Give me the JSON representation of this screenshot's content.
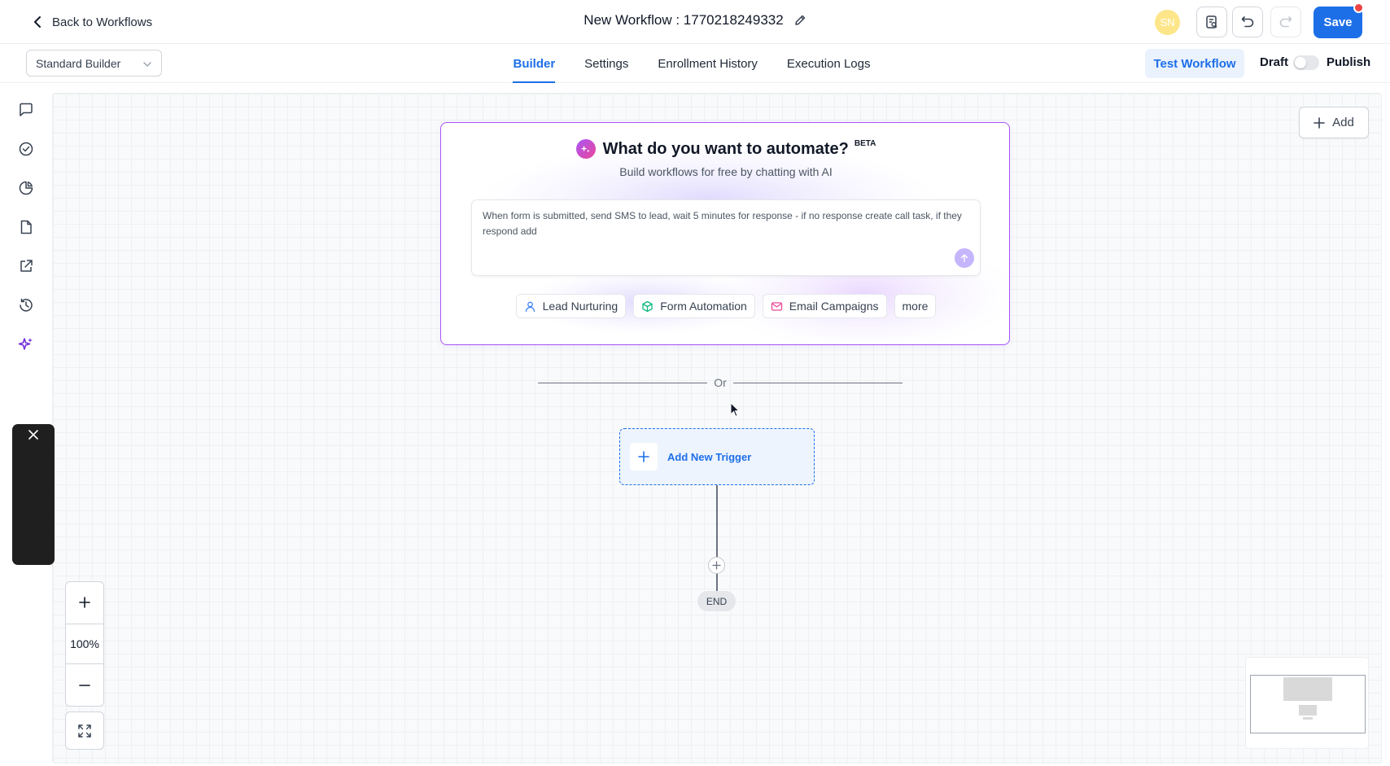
{
  "header": {
    "back_label": "Back to Workflows",
    "workflow_title": "New Workflow : 1770218249332",
    "avatar_initials": "SN",
    "save_label": "Save"
  },
  "subbar": {
    "builder_mode": "Standard Builder",
    "tabs": [
      {
        "label": "Builder",
        "active": true
      },
      {
        "label": "Settings",
        "active": false
      },
      {
        "label": "Enrollment History",
        "active": false
      },
      {
        "label": "Execution Logs",
        "active": false
      }
    ],
    "test_label": "Test Workflow",
    "draft_label": "Draft",
    "publish_label": "Publish",
    "published": false
  },
  "left_rail": {
    "icons": [
      "chat-icon",
      "check-circle-icon",
      "pie-chart-icon",
      "document-icon",
      "external-link-icon",
      "history-icon",
      "sparkles-icon"
    ]
  },
  "ai_card": {
    "title": "What do you want to automate?",
    "badge": "BETA",
    "subtitle": "Build workflows for free by chatting with AI",
    "prompt_text": "When form is submitted, send SMS to lead, wait 5 minutes for response - if no response create call task, if they respond add",
    "chips": [
      {
        "label": "Lead Nurturing",
        "icon": "user-icon"
      },
      {
        "label": "Form Automation",
        "icon": "cube-icon"
      },
      {
        "label": "Email Campaigns",
        "icon": "mail-icon"
      },
      {
        "label": "more",
        "icon": ""
      }
    ]
  },
  "flow": {
    "divider_label": "Or",
    "trigger_label": "Add New Trigger",
    "end_label": "END"
  },
  "canvas": {
    "add_label": "Add",
    "zoom_level": "100%"
  },
  "colors": {
    "accent": "#1d6fe8",
    "ai_border": "#a855f7",
    "notification": "#ef4444",
    "avatar": "#fde68a"
  }
}
